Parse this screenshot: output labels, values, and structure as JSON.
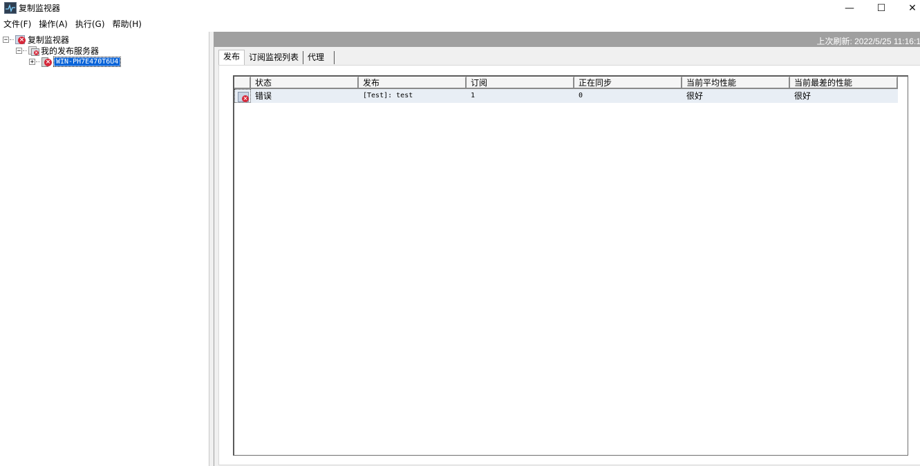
{
  "window": {
    "title": "复制监视器",
    "minimize_glyph": "—",
    "maximize_glyph": "☐",
    "close_glyph": "✕"
  },
  "menu": [
    "文件(F)",
    "操作(A)",
    "执行(G)",
    "帮助(H)"
  ],
  "tree": {
    "root": {
      "label": "复制监视器",
      "expander": "−"
    },
    "publishers": {
      "label": "我的发布服务器",
      "expander": "−"
    },
    "server": {
      "label": "WIN-PH7E470T6U4",
      "expander": "+"
    }
  },
  "status": {
    "refresh_text": "上次刷新: 2022/5/25 11:16:1"
  },
  "tabs": [
    "发布",
    "订阅监视列表",
    "代理"
  ],
  "grid": {
    "columns": [
      "状态",
      "发布",
      "订阅",
      "正在同步",
      "当前平均性能",
      "当前最差的性能"
    ],
    "rows": [
      {
        "status": "错误",
        "publication": "[Test]: test",
        "subscriptions": "1",
        "synchronizing": "0",
        "avg_perf": "很好",
        "worst_perf": "很好"
      }
    ]
  },
  "icons": {
    "app": "replication-monitor-icon",
    "error": "error-x-icon",
    "server": "server-icon"
  },
  "colors": {
    "selection": "#0a64d8",
    "error": "#d6283a",
    "status_bar": "#a0a0a0"
  }
}
